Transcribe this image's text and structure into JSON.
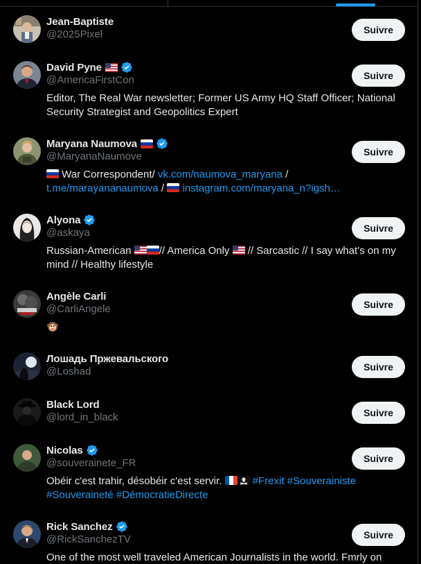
{
  "follow_label": "Suivre",
  "colors": {
    "background": "#000000",
    "accent": "#1d9bf0",
    "muted": "#71767b",
    "text": "#e7e9ea",
    "button_bg": "#eff3f4"
  },
  "users": [
    {
      "name": "Jean-Baptiste",
      "handle": "@2025Pixel",
      "flags": [],
      "verified": false
    },
    {
      "name": "David Pyne",
      "handle": "@AmericaFirstCon",
      "flags": [
        "us-flag"
      ],
      "verified": true,
      "bio": "Editor, The Real War newsletter; Former US Army HQ Staff Officer; National Security Strategist and Geopolitics Expert"
    },
    {
      "name": "Maryana Naumova",
      "handle": "@MaryanaNaumove",
      "flags": [
        "ru-flag"
      ],
      "verified": true,
      "bio_parts": {
        "p1": " War Correspondent/ ",
        "link1": "vk.com/naumova_maryana",
        "p2": " /",
        "link2": "t.me/marayananaumova",
        "p3": " / ",
        "link3": "instagram.com/maryana_n?igsh…"
      }
    },
    {
      "name": "Alyona",
      "handle": "@askaya",
      "flags": [],
      "verified": true,
      "bio_parts": {
        "p1": "Russian-American ",
        "p2": "// America Only ",
        "p3": " // Sarcastic // I say what’s on my mind // Healthy lifestyle"
      }
    },
    {
      "name": "Angèle Carli",
      "handle": "@CarliAngele",
      "flags": [],
      "verified": false,
      "bio_icon": "monkey-face-icon"
    },
    {
      "name": "Лошадь Пржевальского",
      "handle": "@Loshad",
      "flags": [],
      "verified": false
    },
    {
      "name": "Black Lord",
      "handle": "@lord_in_black",
      "flags": [],
      "verified": false
    },
    {
      "name": "Nicolas",
      "handle": "@souverainete_FR",
      "flags": [],
      "verified": true,
      "bio_parts": {
        "p1": "Obéir c'est trahir, désobéir c'est servir. ",
        "link1": "#Frexit",
        "link2": "#Souverainiste",
        "link3": "#Souveraineté",
        "link4": "#DémocratieDirecte"
      }
    },
    {
      "name": "Rick Sanchez",
      "handle": "@RickSanchezTV",
      "flags": [],
      "verified": true,
      "bio": "One of the most well traveled American Journalists in the world. Fmrly on"
    }
  ]
}
